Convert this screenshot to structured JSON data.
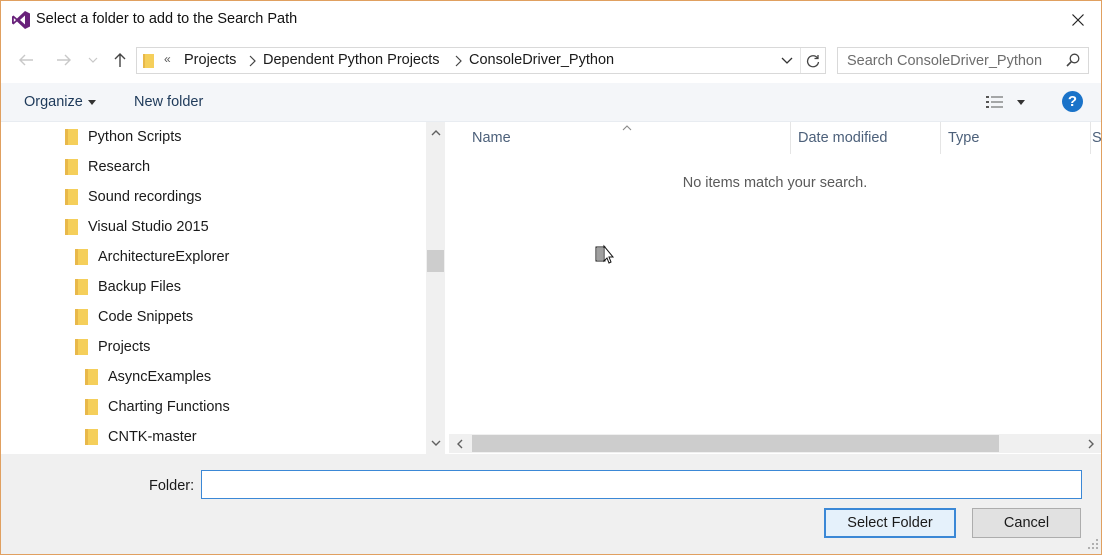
{
  "window": {
    "title": "Select a folder to add to the Search Path"
  },
  "address": {
    "overflow_chevron": "«",
    "crumbs": [
      "Projects",
      "Dependent Python Projects",
      "ConsoleDriver_Python"
    ]
  },
  "search": {
    "placeholder": "Search ConsoleDriver_Python"
  },
  "toolbar": {
    "organize_label": "Organize",
    "new_folder_label": "New folder",
    "help_label": "?"
  },
  "tree": {
    "items": [
      {
        "label": "Python Scripts",
        "level": 0
      },
      {
        "label": "Research",
        "level": 0
      },
      {
        "label": "Sound recordings",
        "level": 0
      },
      {
        "label": "Visual Studio 2015",
        "level": 0
      },
      {
        "label": "ArchitectureExplorer",
        "level": 1
      },
      {
        "label": "Backup Files",
        "level": 1
      },
      {
        "label": "Code Snippets",
        "level": 1
      },
      {
        "label": "Projects",
        "level": 1
      },
      {
        "label": "AsyncExamples",
        "level": 2
      },
      {
        "label": "Charting Functions",
        "level": 2
      },
      {
        "label": "CNTK-master",
        "level": 2
      }
    ]
  },
  "filelist": {
    "columns": [
      "Name",
      "Date modified",
      "Type",
      "S"
    ],
    "empty_message": "No items match your search."
  },
  "footer": {
    "folder_label": "Folder:",
    "folder_value": "",
    "select_button": "Select Folder",
    "cancel_button": "Cancel"
  },
  "colors": {
    "accent": "#3b88d6",
    "help_blue": "#1a73c9",
    "folder_yellow": "#f2c94c",
    "vs_purple": "#68217a"
  }
}
